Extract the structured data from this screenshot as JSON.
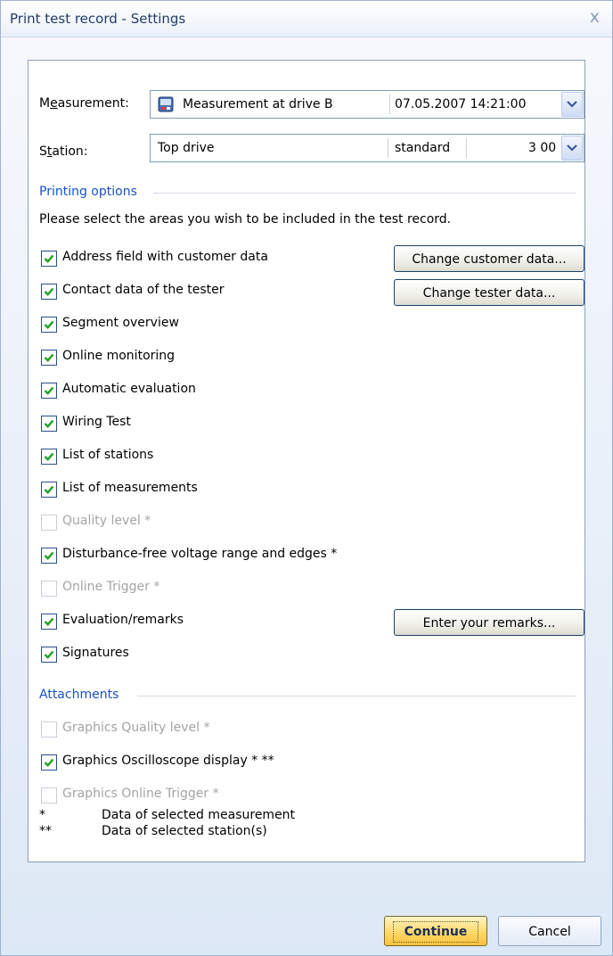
{
  "window": {
    "title": "Print test record - Settings",
    "close_glyph": "x"
  },
  "measurement": {
    "label_pre": "M",
    "label_u": "e",
    "label_post": "asurement:",
    "name": "Measurement at drive B",
    "datetime": "07.05.2007  14:21:00"
  },
  "station": {
    "label_pre": "S",
    "label_u": "t",
    "label_post": "ation:",
    "name": "Top drive",
    "mode": "standard",
    "value": "3 00"
  },
  "printing": {
    "heading": "Printing options",
    "intro": "Please select the areas you wish to be included in the test record.",
    "items": [
      {
        "label": "Address field with customer data",
        "checked": true,
        "enabled": true
      },
      {
        "label": "Contact data of the tester",
        "checked": true,
        "enabled": true
      },
      {
        "label": "Segment overview",
        "checked": true,
        "enabled": true
      },
      {
        "label": "Online monitoring",
        "checked": true,
        "enabled": true
      },
      {
        "label": "Automatic evaluation",
        "checked": true,
        "enabled": true
      },
      {
        "label": "Wiring Test",
        "checked": true,
        "enabled": true
      },
      {
        "label": "List of stations",
        "checked": true,
        "enabled": true
      },
      {
        "label": "List of measurements",
        "checked": true,
        "enabled": true
      },
      {
        "label": "Quality level *",
        "checked": false,
        "enabled": false
      },
      {
        "label": "Disturbance-free voltage range and edges *",
        "checked": true,
        "enabled": true
      },
      {
        "label": "Online Trigger *",
        "checked": false,
        "enabled": false
      },
      {
        "label": "Evaluation/remarks",
        "checked": true,
        "enabled": true
      },
      {
        "label": "Signatures",
        "checked": true,
        "enabled": true
      }
    ],
    "buttons": {
      "customer": "Change customer data...",
      "tester": "Change tester data...",
      "remarks": "Enter your remarks..."
    }
  },
  "attachments": {
    "heading": "Attachments",
    "items": [
      {
        "label": "Graphics Quality level *",
        "checked": false,
        "enabled": false
      },
      {
        "label": "Graphics Oscilloscope display * **",
        "checked": true,
        "enabled": true
      },
      {
        "label": "Graphics Online Trigger *",
        "checked": false,
        "enabled": false
      }
    ]
  },
  "notes": [
    {
      "symbol": "*",
      "text": "Data of selected measurement"
    },
    {
      "symbol": "**",
      "text": "Data of selected station(s)"
    }
  ],
  "footer": {
    "continue_label": "Continue",
    "cancel_label": "Cancel"
  },
  "colors": {
    "accent_blue": "#1a50c8",
    "check_green": "#21a121",
    "continue_yellow": "#ffd968"
  }
}
